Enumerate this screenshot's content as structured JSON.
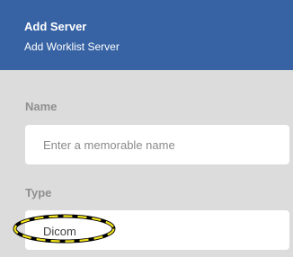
{
  "header": {
    "title": "Add Server",
    "subtitle": "Add Worklist Server"
  },
  "form": {
    "name_label": "Name",
    "name_placeholder": "Enter a memorable name",
    "name_value": "",
    "type_label": "Type",
    "type_value": "Dicom"
  },
  "colors": {
    "header_bg": "#3763a4",
    "body_bg": "#dcdcdc",
    "highlight_yellow": "#f5e51a",
    "highlight_outline": "#000000"
  }
}
